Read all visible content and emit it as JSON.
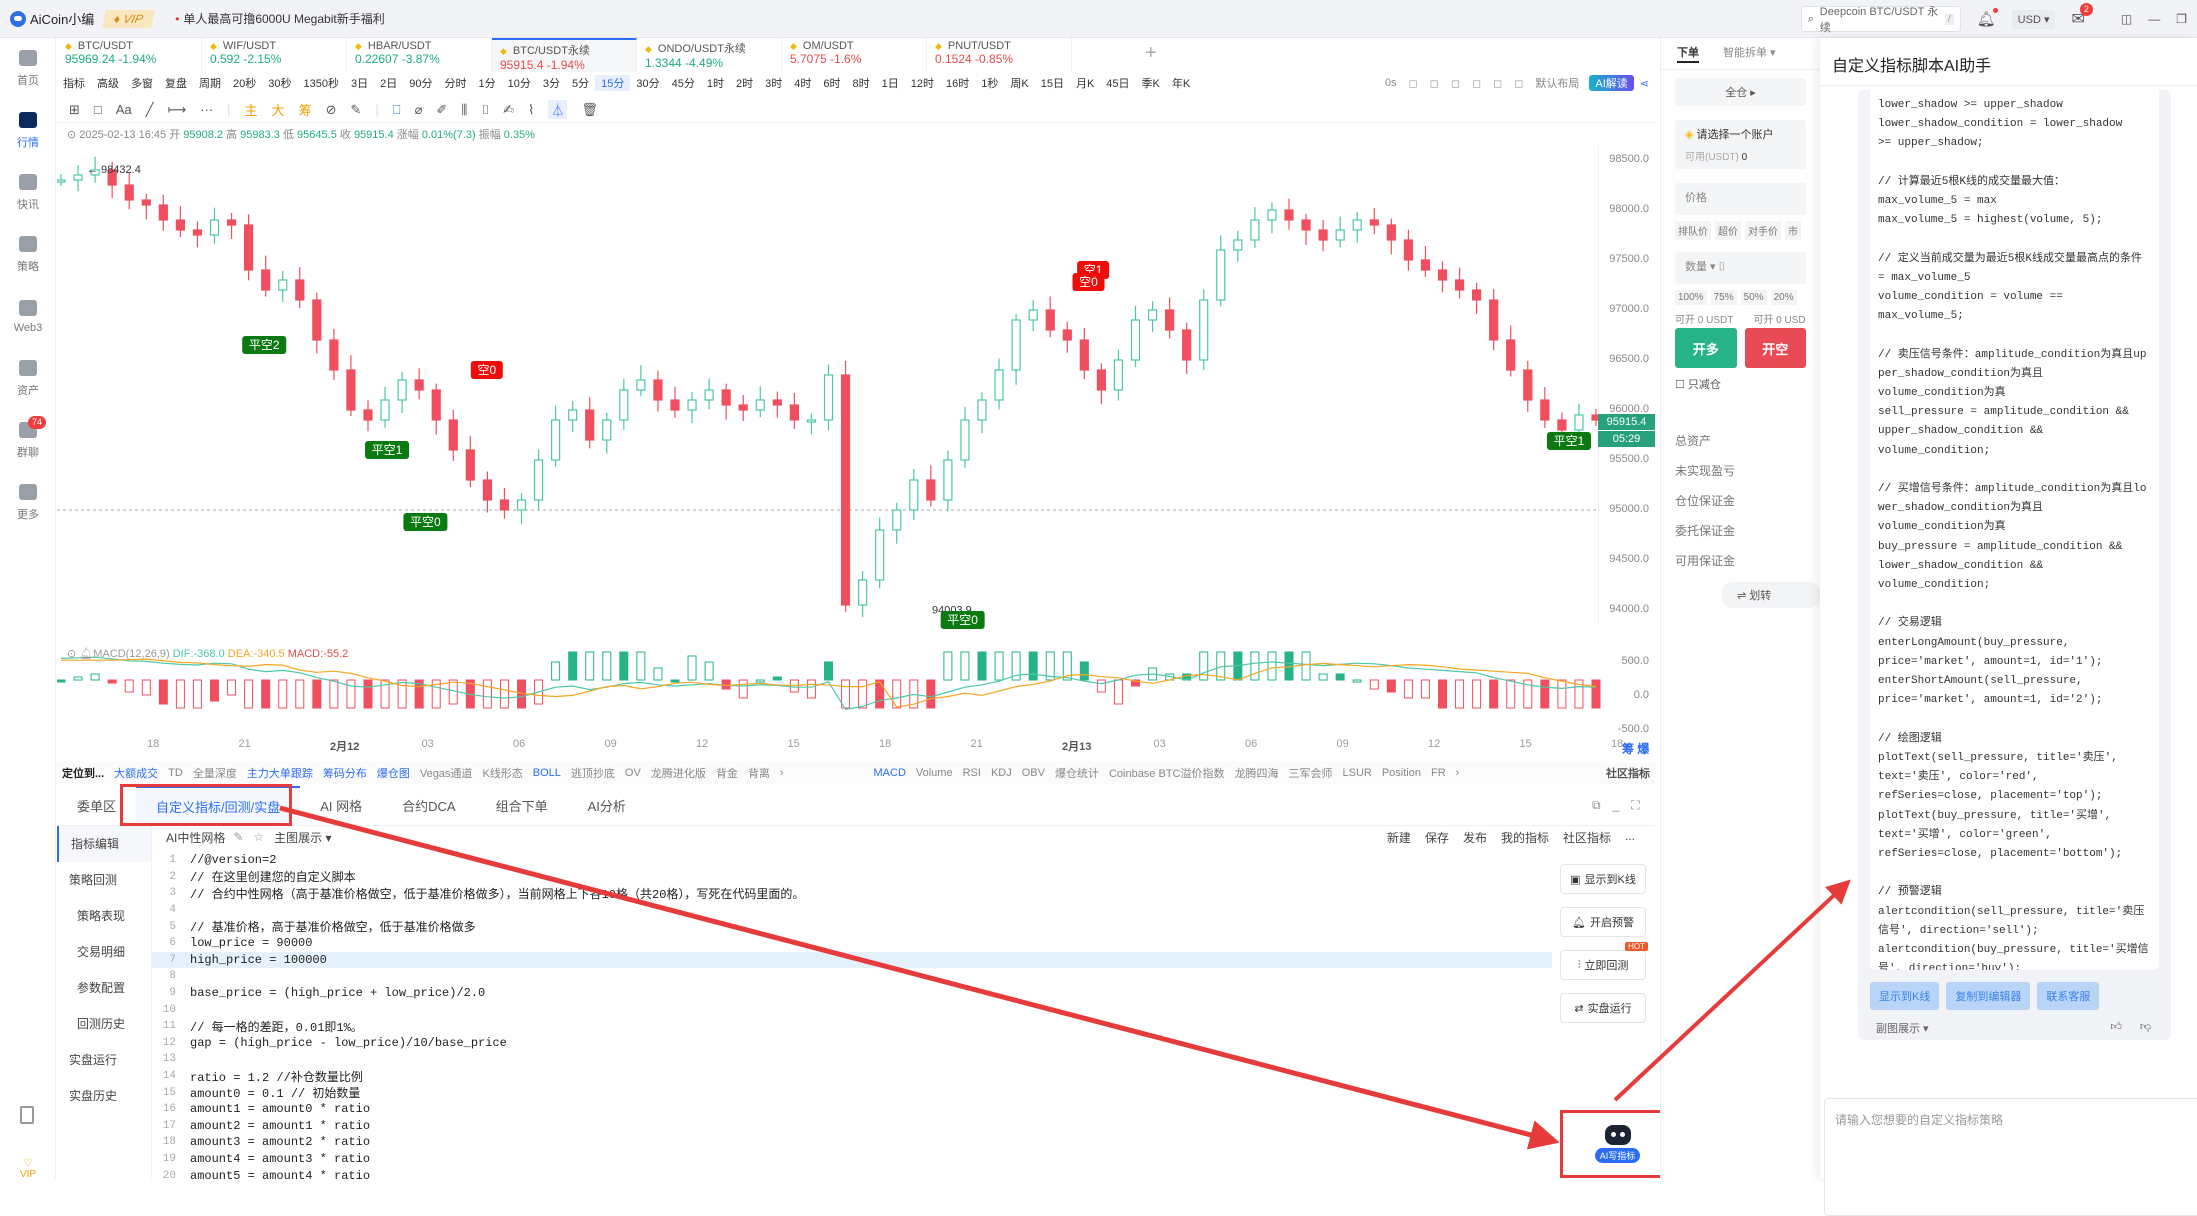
{
  "app": {
    "name": "AiCoin小编",
    "vip": "VIP",
    "promo": "单人最高可撸6000U Megabit新手福利",
    "search_placeholder": "Deepcoin BTC/USDT 永续",
    "search_shortcut": "/",
    "currency": "USD",
    "mail_badge": "2"
  },
  "sidebar": {
    "items": [
      {
        "label": "首页",
        "icon": "home-icon"
      },
      {
        "label": "行情",
        "icon": "market-chart-icon",
        "active": true
      },
      {
        "label": "快讯",
        "icon": "news-icon"
      },
      {
        "label": "策略",
        "icon": "robot-icon"
      },
      {
        "label": "Web3",
        "icon": "web3-icon"
      },
      {
        "label": "资产",
        "icon": "wallet-icon"
      },
      {
        "label": "群聊",
        "icon": "chat-icon",
        "badge": "74"
      },
      {
        "label": "更多",
        "icon": "more-grid-icon"
      }
    ],
    "bottom_vip": "VIP"
  },
  "quote_tabs": [
    {
      "symbol": "BTC/USDT",
      "price": "95969.24",
      "change": "-1.94%",
      "color": "green"
    },
    {
      "symbol": "WIF/USDT",
      "price": "0.592",
      "change": "-2.15%",
      "color": "green"
    },
    {
      "symbol": "HBAR/USDT",
      "price": "0.22607",
      "change": "-3.87%",
      "color": "green"
    },
    {
      "symbol": "BTC/USDT永续",
      "price": "95915.4",
      "change": "-1.94%",
      "color": "red",
      "active": true
    },
    {
      "symbol": "ONDO/USDT永续",
      "price": "1.3344",
      "change": "-4.49%",
      "color": "green"
    },
    {
      "symbol": "OM/USDT",
      "price": "5.7075",
      "change": "-1.6%",
      "color": "red"
    },
    {
      "symbol": "PNUT/USDT",
      "price": "0.1524",
      "change": "-0.85%",
      "color": "red"
    }
  ],
  "toolbar": {
    "left": [
      "指标",
      "高级",
      "多窗",
      "复盘",
      "周期"
    ],
    "periods": [
      "20秒",
      "30秒",
      "1350秒",
      "3日",
      "2日",
      "90分",
      "分时",
      "1分",
      "10分",
      "3分",
      "5分",
      "15分",
      "30分",
      "45分",
      "1时",
      "2时",
      "3时",
      "4时",
      "6时",
      "8时",
      "1日",
      "12时",
      "16时",
      "1秒",
      "周K",
      "15日",
      "月K",
      "45日",
      "季K",
      "年K"
    ],
    "selected_period": "15分",
    "countdown": "0s",
    "layout": "默认布局",
    "ai_read": "AI解读"
  },
  "drawing_tools": [
    "主",
    "大",
    "筹"
  ],
  "ohlc": {
    "datetime": "2025-02-13 16:45",
    "open_label": "开",
    "open": "95908.2",
    "high_label": "高",
    "high": "95983.3",
    "low_label": "低",
    "low": "95645.5",
    "close_label": "收",
    "close": "95915.4",
    "chg_label": "涨幅",
    "chg": "0.01%(7.3)",
    "amp_label": "振幅",
    "amp": "0.35%"
  },
  "chart_data": {
    "type": "candlestick",
    "symbol": "BTC/USDT永续",
    "interval": "15分",
    "price_axis": [
      "98500.0",
      "98000.0",
      "97500.0",
      "97000.0",
      "96500.0",
      "96000.0",
      "95500.0",
      "95000.0",
      "94500.0",
      "94000.0"
    ],
    "ylim": [
      93850,
      98650
    ],
    "current_price": "95915.4",
    "countdown": "05:29",
    "max_label": "98432.4",
    "min_label": "94003.9",
    "time_axis": [
      "18",
      "21",
      "2月12",
      "03",
      "06",
      "09",
      "12",
      "15",
      "18",
      "21",
      "2月13",
      "03",
      "06",
      "09",
      "12",
      "15",
      "18"
    ],
    "close_path": [
      98300,
      98350,
      98400,
      98250,
      98100,
      98050,
      97900,
      97800,
      97750,
      97900,
      97850,
      97400,
      97200,
      97300,
      97100,
      96700,
      96400,
      96000,
      95900,
      96100,
      96300,
      96200,
      95900,
      95600,
      95300,
      95100,
      95000,
      95100,
      95500,
      95900,
      96000,
      95700,
      95900,
      96200,
      96300,
      96100,
      96000,
      96100,
      96200,
      96050,
      96000,
      96100,
      96050,
      95900,
      95900,
      96350,
      94050,
      94300,
      94800,
      95000,
      95300,
      95100,
      95500,
      95900,
      96100,
      96400,
      96900,
      97000,
      96800,
      96700,
      96400,
      96200,
      96500,
      96900,
      97000,
      96800,
      96500,
      97100,
      97600,
      97700,
      97900,
      98000,
      97900,
      97800,
      97700,
      97800,
      97900,
      97850,
      97700,
      97500,
      97400,
      97300,
      97200,
      97100,
      96700,
      96400,
      96100,
      95900,
      95800,
      95950,
      95900
    ],
    "signals": [
      {
        "label": "平空2",
        "type": "close-short",
        "x_pct": 0.135,
        "price": 96650
      },
      {
        "label": "平空1",
        "type": "close-short",
        "x_pct": 0.215,
        "price": 95600
      },
      {
        "label": "平空0",
        "type": "close-short",
        "x_pct": 0.24,
        "price": 94880
      },
      {
        "label": "空0",
        "type": "short",
        "x_pct": 0.28,
        "price": 96400
      },
      {
        "label": "平空0",
        "type": "close-short",
        "x_pct": 0.59,
        "price": 93900
      },
      {
        "label": "空1",
        "type": "short",
        "x_pct": 0.675,
        "price": 97400
      },
      {
        "label": "空0",
        "type": "short",
        "x_pct": 0.672,
        "price": 97280
      },
      {
        "label": "平空1",
        "type": "close-short",
        "x_pct": 0.985,
        "price": 95690
      }
    ],
    "macd": {
      "title": "MACD(12,26,9)",
      "dif": "-368.0",
      "dea": "-340.5",
      "macd": "-55.2",
      "axis": [
        "500.0",
        "0.0",
        "-500.0"
      ]
    }
  },
  "indicator_bar": {
    "locate": "定位到...",
    "main": [
      "大额成交",
      "TD",
      "全量深度",
      "主力大单跟踪",
      "筹码分布",
      "爆仓图",
      "Vegas通道",
      "K线形态",
      "BOLL",
      "逃顶抄底",
      "OV",
      "龙腾进化版",
      "背金",
      "背离"
    ],
    "sub": [
      "MACD",
      "Volume",
      "RSI",
      "KDJ",
      "OBV",
      "爆仓统计",
      "Coinbase BTC溢价指数",
      "龙腾四海",
      "三军会师",
      "LSUR",
      "Position",
      "FR"
    ],
    "community": "社区指标",
    "axis_tags": [
      "筹",
      "爆"
    ]
  },
  "bottom_tabs": [
    "委单区",
    "自定义指标/回测/实盘",
    "AI 网格",
    "合约DCA",
    "组合下单",
    "AI分析"
  ],
  "bottom_side": [
    "指标编辑",
    "策略回测",
    "策略表现",
    "交易明细",
    "参数配置",
    "回测历史",
    "实盘运行",
    "实盘历史"
  ],
  "editor": {
    "script_name": "AI中性网格",
    "display_mode": "主图展示",
    "actions": [
      "新建",
      "保存",
      "发布",
      "我的指标",
      "社区指标",
      "..."
    ],
    "lines": [
      {
        "n": "1",
        "t": "//@version=2"
      },
      {
        "n": "2",
        "t": "// 在这里创建您的自定义脚本"
      },
      {
        "n": "3",
        "t": "// 合约中性网格（高于基准价格做空，低于基准价格做多），当前网格上下各10格（共20格），写死在代码里面的。"
      },
      {
        "n": "4",
        "t": ""
      },
      {
        "n": "5",
        "t": "// 基准价格，高于基准价格做空，低于基准价格做多"
      },
      {
        "n": "6",
        "t": "low_price = 90000"
      },
      {
        "n": "7",
        "t": "high_price = 100000"
      },
      {
        "n": "8",
        "t": ""
      },
      {
        "n": "9",
        "t": "base_price = (high_price + low_price)/2.0"
      },
      {
        "n": "10",
        "t": ""
      },
      {
        "n": "11",
        "t": "// 每一格的差距，0.01即1%。"
      },
      {
        "n": "12",
        "t": "gap = (high_price - low_price)/10/base_price"
      },
      {
        "n": "13",
        "t": ""
      },
      {
        "n": "14",
        "t": "ratio = 1.2 //补仓数量比例"
      },
      {
        "n": "15",
        "t": "amount0 = 0.1 // 初始数量"
      },
      {
        "n": "16",
        "t": "amount1 = amount0 * ratio"
      },
      {
        "n": "17",
        "t": "amount2 = amount1 * ratio"
      },
      {
        "n": "18",
        "t": "amount3 = amount2 * ratio"
      },
      {
        "n": "19",
        "t": "amount4 = amount3 * ratio"
      },
      {
        "n": "20",
        "t": "amount5 = amount4 * ratio"
      }
    ],
    "side_buttons": [
      "显示到K线",
      "开启预警",
      "立即回测",
      "实盘运行"
    ],
    "hot": "HOT",
    "ai_write": "AI写指标"
  },
  "trade_panel": {
    "tabs": [
      "下单",
      "智能拆单"
    ],
    "margin_mode": "全仓",
    "account_placeholder": "请选择一个账户",
    "available_label": "可用(USDT)",
    "available": "0",
    "price_placeholder": "价格",
    "price_pills": [
      "排队价",
      "超价",
      "对手价",
      "市"
    ],
    "qty_label": "数量",
    "pct_pills": [
      "100%",
      "75%",
      "50%",
      "20%"
    ],
    "can_open_long": "可开 0 USDT",
    "can_open_short": "可开 0 USD",
    "open_long": "开多",
    "open_short": "开空",
    "reduce_only": "只减仓",
    "stats": [
      "总资产",
      "未实现盈亏",
      "仓位保证金",
      "委托保证金",
      "可用保证金"
    ],
    "transfer": "⇌ 划转"
  },
  "ai_panel": {
    "title": "自定义指标脚本AI助手",
    "code": "lower_shadow >= upper_shadow\nlower_shadow_condition = lower_shadow\n>= upper_shadow;\n\n// 计算最近5根K线的成交量最大值：\nmax_volume_5 = max\nmax_volume_5 = highest(volume, 5);\n\n// 定义当前成交量为最近5根K线成交量最高点的条件 = max_volume_5\nvolume_condition = volume ==\nmax_volume_5;\n\n// 卖压信号条件：amplitude_condition为真且upper_shadow_condition为真且\nvolume_condition为真\nsell_pressure = amplitude_condition &&\nupper_shadow_condition &&\nvolume_condition;\n\n// 买增信号条件：amplitude_condition为真且lower_shadow_condition为真且\nvolume_condition为真\nbuy_pressure = amplitude_condition &&\nlower_shadow_condition &&\nvolume_condition;\n\n// 交易逻辑\nenterLongAmount(buy_pressure,\nprice='market', amount=1, id='1');\nenterShortAmount(sell_pressure,\nprice='market', amount=1, id='2');\n\n// 绘图逻辑\nplotText(sell_pressure, title='卖压',\ntext='卖压', color='red',\nrefSeries=close, placement='top');\nplotText(buy_pressure, title='买增',\ntext='买增', color='green',\nrefSeries=close, placement='bottom');\n\n// 预警逻辑\nalertcondition(sell_pressure, title='卖压信号', direction='sell');\nalertcondition(buy_pressure, title='买增信号', direction='buy');",
    "actions": [
      "显示到K线",
      "复制到编辑器",
      "联系客服"
    ],
    "display_mode": "副图展示",
    "input_placeholder": "请输入您想要的自定义指标策略"
  },
  "colors": {
    "accent": "#2a6df4",
    "up": "#1fae7e",
    "down": "#e84b4b",
    "annotation": "#e63b3b"
  }
}
